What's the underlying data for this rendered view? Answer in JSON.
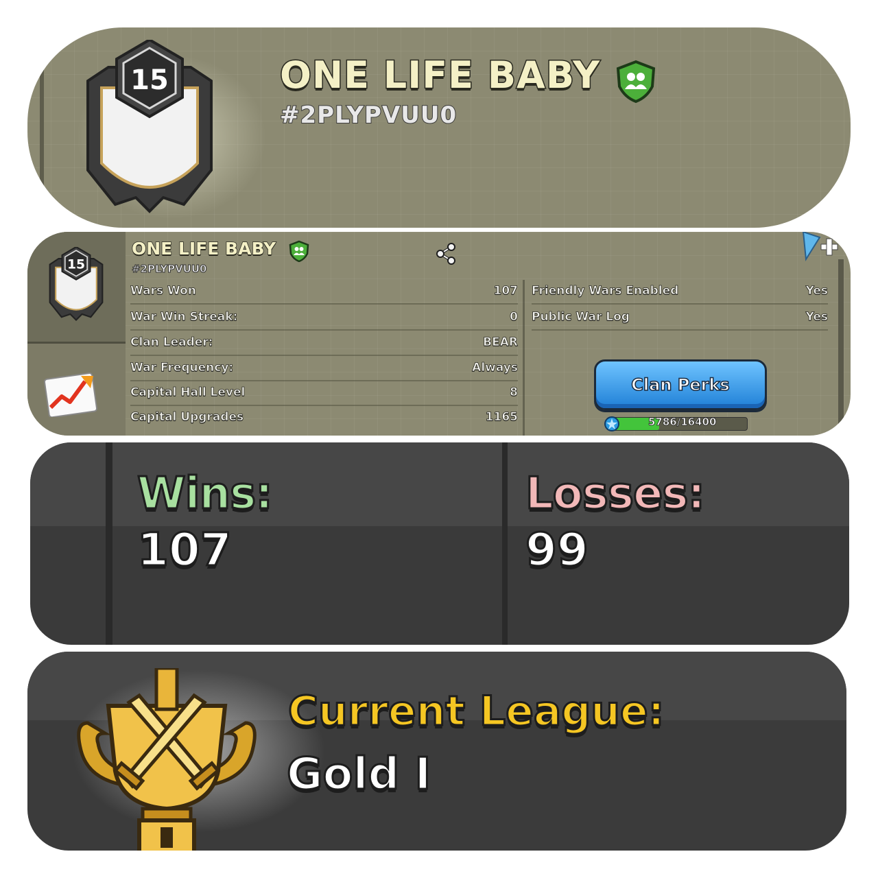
{
  "clan": {
    "level": "15",
    "name": "ONE LIFE BABY",
    "tag": "#2PLYPVUU0"
  },
  "details": {
    "left_rows": [
      {
        "label": "Wars Won",
        "value": "107"
      },
      {
        "label": "War Win Streak:",
        "value": "0"
      },
      {
        "label": "Clan Leader:",
        "value": "BEAR"
      },
      {
        "label": "War Frequency:",
        "value": "Always"
      },
      {
        "label": "Capital Hall Level",
        "value": "8"
      },
      {
        "label": "Capital Upgrades",
        "value": "1165"
      }
    ],
    "right_rows": [
      {
        "label": "Friendly Wars Enabled",
        "value": "Yes"
      },
      {
        "label": "Public War Log",
        "value": "Yes"
      }
    ],
    "perks_button": "Clan Perks",
    "xp": {
      "text": "5786/16400",
      "current": 5786,
      "max": 16400
    }
  },
  "war_record": {
    "wins_label": "Wins:",
    "wins_value": "107",
    "losses_label": "Losses:",
    "losses_value": "99",
    "wins_color": "#a8e0a0",
    "losses_color": "#f2b8b8"
  },
  "league": {
    "label": "Current League:",
    "value": "Gold I"
  },
  "colors": {
    "map_bg": "#8c8a72",
    "dark_panel": "#3a3a3a",
    "accent_gold": "#f5c623",
    "button_blue": "#2b8ee6"
  }
}
